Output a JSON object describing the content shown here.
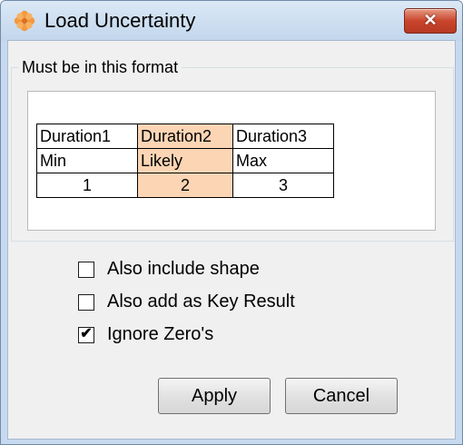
{
  "window": {
    "title": "Load Uncertainty",
    "icon": "orange-flower-icon",
    "close_label": "✕"
  },
  "format_group": {
    "caption": "Must be in this format",
    "table": {
      "rows": [
        [
          "Duration1",
          "Duration2",
          "Duration3"
        ],
        [
          "Min",
          "Likely",
          "Max"
        ],
        [
          "1",
          "2",
          "3"
        ]
      ],
      "highlight_column": 1,
      "highlight_color": "#fcd5b4"
    }
  },
  "options": [
    {
      "label": "Also include shape",
      "checked": false
    },
    {
      "label": "Also add as Key Result",
      "checked": false
    },
    {
      "label": "Ignore Zero's",
      "checked": true
    }
  ],
  "buttons": {
    "apply": "Apply",
    "cancel": "Cancel"
  },
  "colors": {
    "titlebar": "#c7d9ee",
    "close_button": "#c9452c",
    "client": "#f0f0f0"
  }
}
